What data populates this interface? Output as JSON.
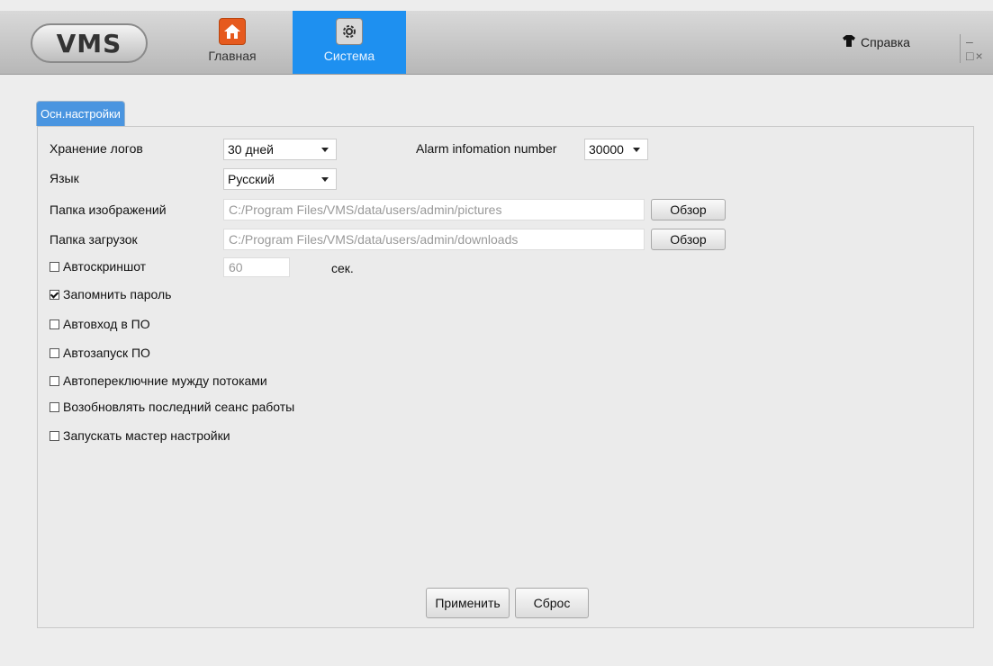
{
  "header": {
    "logo": "VMS",
    "nav": [
      {
        "label": "Главная",
        "icon": "home-icon"
      },
      {
        "label": "Система",
        "icon": "gear-icon",
        "active": true
      }
    ],
    "help_label": "Справка",
    "help_icon": "shirt-icon",
    "accent_color": "#1e90f0"
  },
  "tabs": [
    {
      "label": "Осн.настройки",
      "active": true
    }
  ],
  "settings": {
    "log_label": "Хранение логов",
    "log_value": "30 дней",
    "alarm_label": "Alarm infomation number",
    "alarm_value": "30000",
    "lang_label": "Язык",
    "lang_value": "Русский",
    "pictures_label": "Папка изображений",
    "pictures_path": "C:/Program Files/VMS/data/users/admin/pictures",
    "downloads_label": "Папка загрузок",
    "downloads_path": "C:/Program Files/VMS/data/users/admin/downloads",
    "browse_label": "Обзор",
    "autoshot_label": "Автоскриншот",
    "autoshot_checked": false,
    "autoshot_value": "60",
    "autoshot_unit": "сек.",
    "checkboxes": [
      {
        "label": "Запомнить пароль",
        "checked": true
      },
      {
        "label": "Автовход в ПО",
        "checked": false
      },
      {
        "label": "Автозапуск ПО",
        "checked": false
      },
      {
        "label": "Автопереключние мужду потоками",
        "checked": false
      },
      {
        "label": "Возобновлять последний сеанс работы",
        "checked": false
      },
      {
        "label": "Запускать мастер настройки",
        "checked": false
      }
    ]
  },
  "actions": {
    "apply_label": "Применить",
    "reset_label": "Сброс"
  }
}
